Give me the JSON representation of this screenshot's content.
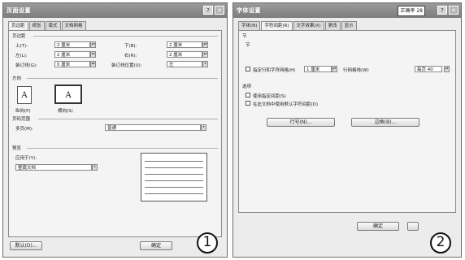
{
  "window1": {
    "title": "页面设置",
    "tabs": [
      "页边距",
      "纸张",
      "版式",
      "文档网格"
    ],
    "margins_group": "页边距",
    "rows": [
      {
        "left_label": "上(T):",
        "left_value": "2 厘米",
        "right_label": "下(B):",
        "right_value": "2 厘米"
      },
      {
        "left_label": "左(L):",
        "left_value": "2 厘米",
        "right_label": "右(R):",
        "right_value": "2 厘米"
      },
      {
        "left_label": "装订线(G):",
        "left_value": "0 厘米",
        "right_label": "装订线位置(U):",
        "right_value": "左"
      }
    ],
    "orientation_group": "方向",
    "portrait_label": "纵向(P)",
    "landscape_label": "横向(S)",
    "pages_group": "页码范围",
    "multiple_pages_label": "多页(M):",
    "multiple_pages_value": "普通",
    "preview_group": "预览",
    "apply_to_label": "应用于(Y):",
    "apply_to_value": "整篇文档",
    "default_button": "默认(D)...",
    "ok_button": "确定",
    "annotation": "1"
  },
  "window2": {
    "title": "字体设置",
    "title_badge": "正确率 28",
    "tabs": [
      "字体(N)",
      "字符间距(R)",
      "文字效果(X)",
      "更改",
      "显示"
    ],
    "section_group": "节",
    "section_sub": "节",
    "grid_label": "指定行和字符网格(H)",
    "grid_value_1": "1 厘米",
    "grid_label_2": "行网格线(W)",
    "grid_value_2": "每页 40",
    "options_group": "选项",
    "option_1": "使用指定间距(S)",
    "option_2": "在此文档中使用默认字符间距(D)",
    "left_button": "行号(N)...",
    "right_button": "边框(B)...",
    "ok_button": "确定",
    "annotation": "2"
  }
}
